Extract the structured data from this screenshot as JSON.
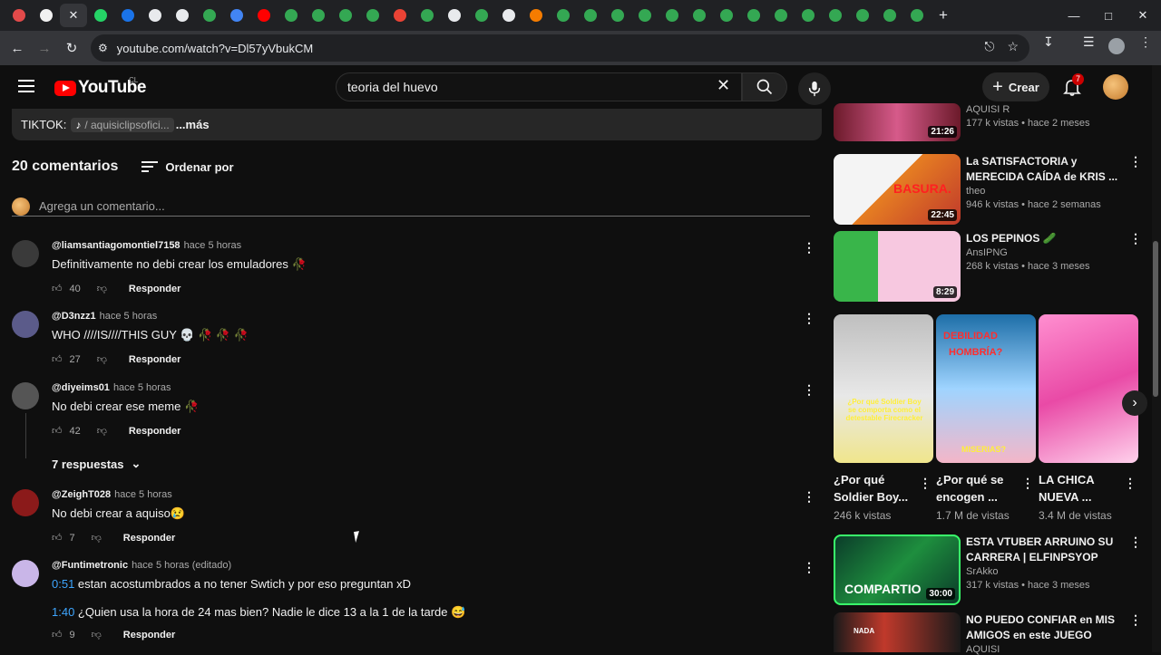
{
  "browser": {
    "url": "youtube.com/watch?v=Dl57yVbukCM",
    "tab_colors": [
      "#e24a4a",
      "#f1f1f1",
      "#e8eaed",
      "#25d366",
      "#1a73e8",
      "#e8eaed",
      "#e8eaed",
      "#34a853",
      "#4285f4",
      "#ff0000",
      "#34a853",
      "#34a853",
      "#34a853",
      "#34a853",
      "#ea4335",
      "#34a853",
      "#e8eaed",
      "#34a853",
      "#e8eaed",
      "#f57c00",
      "#34a853",
      "#34a853",
      "#34a853",
      "#34a853",
      "#34a853",
      "#34a853",
      "#34a853",
      "#34a853",
      "#34a853",
      "#34a853",
      "#34a853",
      "#34a853",
      "#34a853",
      "#34a853"
    ]
  },
  "header": {
    "logo_text": "YouTube",
    "country": "CL",
    "search_query": "teoria del huevo",
    "create_label": "Crear",
    "notifications_count": "7"
  },
  "description": {
    "prefix": "TIKTOK:",
    "link_text": "/ aquisiclipsofici...",
    "more": "...más"
  },
  "comments": {
    "count_label": "20 comentarios",
    "sort_label": "Ordenar por",
    "add_placeholder": "Agrega un comentario...",
    "reply_label": "Responder",
    "replies_toggle": "7 respuestas",
    "items": [
      {
        "author": "@liamsantiagomontiel7158",
        "time": "hace 5 horas",
        "text": "Definitivamente no debi crear los emuladores 🥀",
        "likes": "40"
      },
      {
        "author": "@D3nzz1",
        "time": "hace 5 horas",
        "text": "WHO ////IS////THIS GUY 💀 🥀 🥀 🥀",
        "likes": "27"
      },
      {
        "author": "@diyeims01",
        "time": "hace 5 horas",
        "text": "No debi crear ese meme 🥀",
        "likes": "42"
      },
      {
        "author": "@ZeighT028",
        "time": "hace 5 horas",
        "text": "No debi crear a aquiso😢",
        "likes": "7"
      },
      {
        "author": "@Funtimetronic",
        "time": "hace 5 horas (editado)",
        "ts1": "0:51",
        "text": " estan acostumbrados a no tener Swtich y por eso preguntan xD",
        "ts2": "1:40",
        "text2": " ¿Quien usa la hora de 24 mas bien? Nadie le dice 13 a la 1 de la tarde 😅",
        "likes": "9"
      }
    ]
  },
  "recommendations": [
    {
      "title": "",
      "channel": "AQUISI R",
      "stats": "177 k vistas • hace 2 meses",
      "duration": "21:26",
      "color": "#c0392b"
    },
    {
      "title": "La SATISFACTORIA y MERECIDA CAÍDA de KRIS ...",
      "channel": "theo",
      "stats": "946 k vistas • hace 2 semanas",
      "duration": "22:45",
      "thumb_text": "BASURA.",
      "color": "#e67e22"
    },
    {
      "title": "LOS PEPINOS 🥒",
      "channel": "AnsIPNG",
      "stats": "268 k vistas • hace 3 meses",
      "duration": "8:29",
      "color": "#f7a8d8"
    },
    {
      "title": "ESTA VTUBER ARRUINO SU CARRERA | ELFINPSYOP",
      "channel": "SrAkko",
      "stats": "317 k vistas • hace 3 meses",
      "duration": "30:00",
      "thumb_text": "COMPARTIO",
      "color": "#1e8e3e"
    },
    {
      "title": "NO PUEDO CONFIAR en MIS AMIGOS en este JUEGO",
      "channel": "AQUISI",
      "stats": "",
      "duration": "",
      "thumb_text": "NADA",
      "color": "#c0392b"
    }
  ],
  "shorts": [
    {
      "title": "¿Por qué Soldier Boy...",
      "views": "246 k vistas",
      "caption": "¿Por qué Soldier Boy se comporta como el detestable Firecracker",
      "color": "#d9d9d9"
    },
    {
      "title": "¿Por qué se encogen ...",
      "views": "1.7 M de vistas",
      "caption": "DEBILIDAD",
      "caption2": "HOMBRÍA?",
      "caption3": "MISERIAS?",
      "color": "#cce6ff"
    },
    {
      "title": "LA CHICA NUEVA ...",
      "views": "3.4 M de vistas",
      "color": "#e94aa6"
    }
  ]
}
